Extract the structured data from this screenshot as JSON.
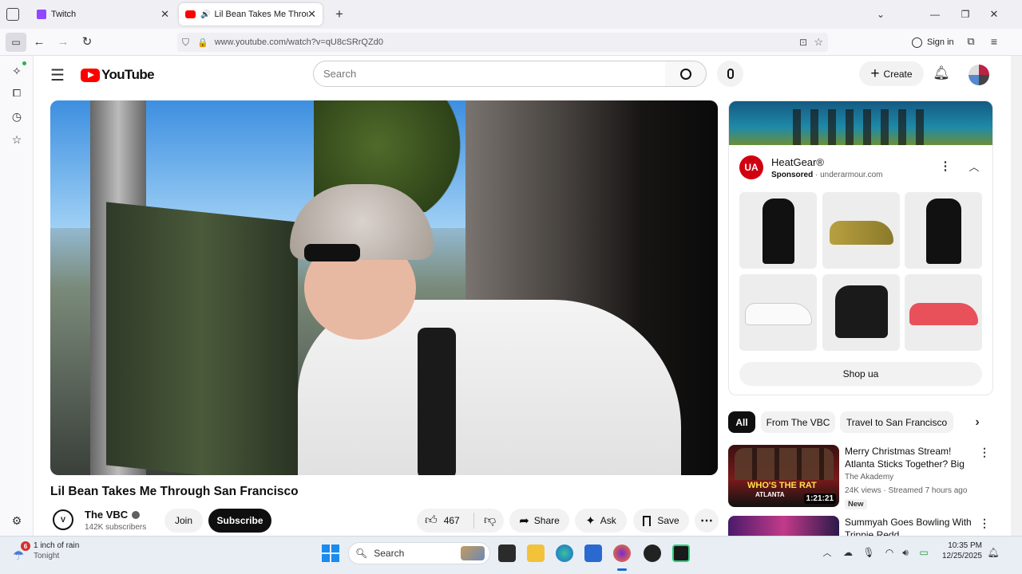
{
  "browser": {
    "tabs": [
      {
        "label": "Twitch",
        "active": false
      },
      {
        "label": "Lil Bean Takes Me Through",
        "active": true
      }
    ],
    "url": "www.youtube.com/watch?v=qU8cSRrQZd0",
    "sign_in": "Sign in"
  },
  "youtube": {
    "logo_text": "YouTube",
    "search_placeholder": "Search",
    "create_label": "Create",
    "video": {
      "title": "Lil Bean Takes Me Through San Francisco",
      "channel": "The VBC",
      "subscribers": "142K subscribers",
      "join_label": "Join",
      "subscribe_label": "Subscribe",
      "likes": "467",
      "share_label": "Share",
      "ask_label": "Ask",
      "save_label": "Save"
    },
    "ad": {
      "brand": "HeatGear®",
      "sponsored": "Sponsored",
      "domain": "underarmour.com",
      "cta": "Shop ua"
    },
    "chips": [
      "All",
      "From The VBC",
      "Travel to San Francisco"
    ],
    "recommendations": [
      {
        "title": "Merry Christmas Stream! Atlanta Sticks Together? Big ...",
        "channel": "The Akademy",
        "meta": "24K views · Streamed 7 hours ago",
        "badge": "New",
        "duration": "1:21:21",
        "thumb_text": "WHO'S THE RAT",
        "thumb_sub": "ATLANTA"
      },
      {
        "title": "Summyah Goes Bowling With Trippie Redd",
        "channel": "",
        "meta": "",
        "badge": "",
        "duration": "",
        "thumb_text": "",
        "thumb_sub": ""
      }
    ]
  },
  "taskbar": {
    "weather_badge": "6",
    "weather_title": "1 inch of rain",
    "weather_sub": "Tonight",
    "search_label": "Search",
    "time": "10:35 PM",
    "date": "12/25/2025"
  }
}
